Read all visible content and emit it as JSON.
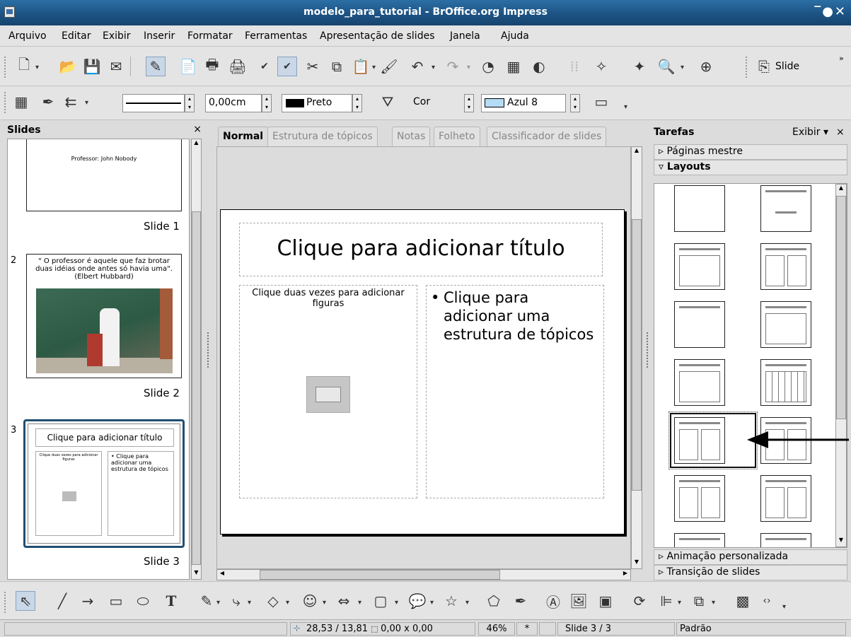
{
  "window": {
    "title": "modelo_para_tutorial - BrOffice.org Impress"
  },
  "menu": [
    "Arquivo",
    "Editar",
    "Exibir",
    "Inserir",
    "Formatar",
    "Ferramentas",
    "Apresentação de slides",
    "Janela",
    "Ajuda"
  ],
  "toolbar": {
    "slide_label": "Slide"
  },
  "line_toolbar": {
    "line_width": "0,00cm",
    "line_color": "Preto",
    "area_style": "Cor",
    "area_color": "Azul 8"
  },
  "slides_panel": {
    "title": "Slides",
    "close": "×",
    "slides": [
      {
        "number": "",
        "label": "Slide 1",
        "text": "Professor: John Nobody"
      },
      {
        "number": "2",
        "label": "Slide 2",
        "text": "\" O professor é aquele que faz brotar duas idéias onde antes só havia uma\". (Elbert Hubbard)"
      },
      {
        "number": "3",
        "label": "Slide 3",
        "title": "Clique para adicionar título",
        "left_text": "Clique duas vezes para adicionar figuras",
        "right_text": "• Clique para adicionar uma estrutura de tópicos"
      }
    ]
  },
  "tabs": [
    "Normal",
    "Estrutura de tópicos",
    "Notas",
    "Folheto",
    "Classificador de slides"
  ],
  "slide": {
    "title": "Clique para adicionar título",
    "left_text": "Clique duas vezes para adicionar figuras",
    "bullet": "•",
    "right_text": "Clique para adicionar uma estrutura de tópicos"
  },
  "tasks": {
    "title": "Tarefas",
    "view": "Exibir",
    "close": "×",
    "sections": {
      "master": "Páginas mestre",
      "layouts": "Layouts",
      "animation": "Animação personalizada",
      "transition": "Transição de slides"
    }
  },
  "status": {
    "position": "28,53 / 13,81",
    "size": "0,00 x 0,00",
    "zoom": "46%",
    "modified": "*",
    "slide": "Slide 3 / 3",
    "style": "Padrão"
  }
}
